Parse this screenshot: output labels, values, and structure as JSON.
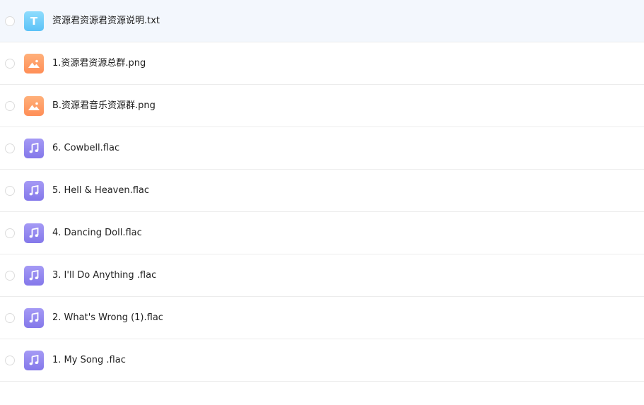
{
  "files": [
    {
      "name": "资源君资源君资源说明.txt",
      "type": "text",
      "icon": "text-file-icon",
      "icon_glyph": "T"
    },
    {
      "name": "1.资源君资源总群.png",
      "type": "image",
      "icon": "image-file-icon"
    },
    {
      "name": "B.资源君音乐资源群.png",
      "type": "image",
      "icon": "image-file-icon"
    },
    {
      "name": "6. Cowbell.flac",
      "type": "audio",
      "icon": "music-file-icon"
    },
    {
      "name": "5. Hell & Heaven.flac",
      "type": "audio",
      "icon": "music-file-icon"
    },
    {
      "name": "4. Dancing Doll.flac",
      "type": "audio",
      "icon": "music-file-icon"
    },
    {
      "name": "3. I'll Do Anything .flac",
      "type": "audio",
      "icon": "music-file-icon"
    },
    {
      "name": "2. What's Wrong (1).flac",
      "type": "audio",
      "icon": "music-file-icon"
    },
    {
      "name": "1. My Song .flac",
      "type": "audio",
      "icon": "music-file-icon"
    }
  ],
  "colors": {
    "text_icon": "#5bc2f7",
    "image_icon": "#ff8e57",
    "audio_icon": "#8478ea",
    "selected_row_bg": "#f3f7fd"
  }
}
